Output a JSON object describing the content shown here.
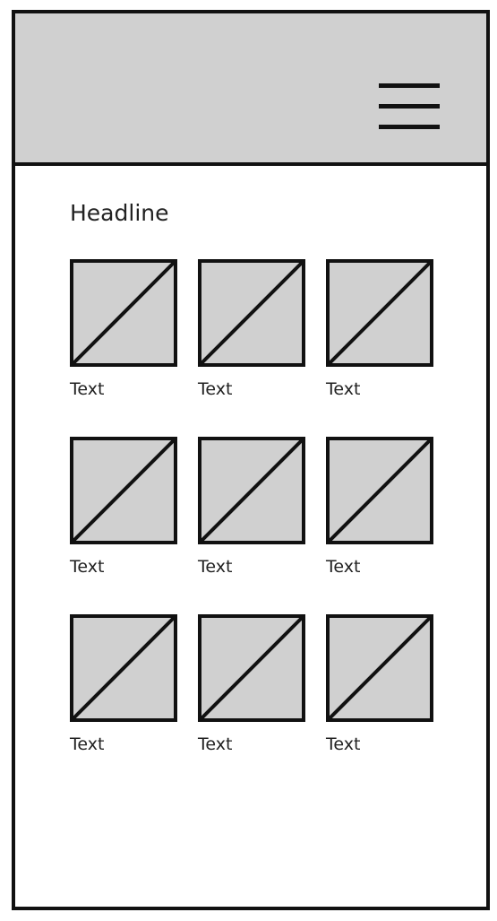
{
  "header": {
    "menu_icon": "hamburger-menu-icon"
  },
  "main": {
    "headline": "Headline",
    "items": [
      {
        "label": "Text",
        "icon": "image-placeholder-icon"
      },
      {
        "label": "Text",
        "icon": "image-placeholder-icon"
      },
      {
        "label": "Text",
        "icon": "image-placeholder-icon"
      },
      {
        "label": "Text",
        "icon": "image-placeholder-icon"
      },
      {
        "label": "Text",
        "icon": "image-placeholder-icon"
      },
      {
        "label": "Text",
        "icon": "image-placeholder-icon"
      },
      {
        "label": "Text",
        "icon": "image-placeholder-icon"
      },
      {
        "label": "Text",
        "icon": "image-placeholder-icon"
      },
      {
        "label": "Text",
        "icon": "image-placeholder-icon"
      }
    ]
  },
  "colors": {
    "header_bg": "#d0d0d0",
    "placeholder_fill": "#d0d0d0",
    "stroke": "#111111"
  }
}
